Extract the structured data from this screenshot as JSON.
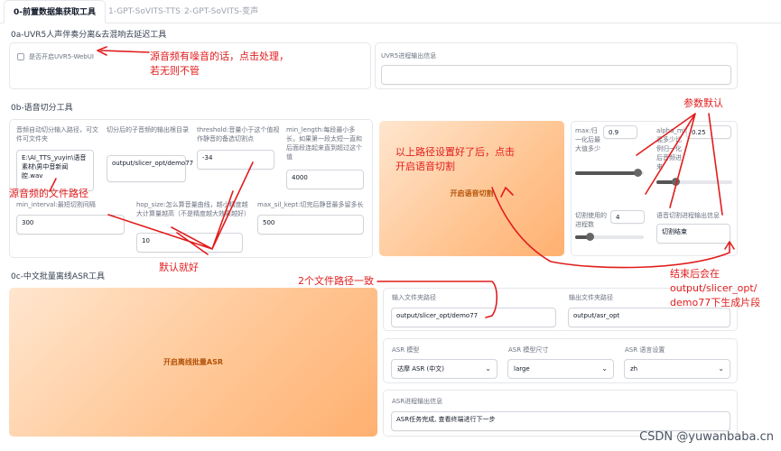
{
  "tabs": [
    {
      "label": "0-前置数据集获取工具"
    },
    {
      "label": "1-GPT-SoVITS-TTS"
    },
    {
      "label": "2-GPT-SoVITS-变声"
    }
  ],
  "uvr": {
    "title": "0a-UVR5人声伴奏分离&去混响去延迟工具",
    "checkbox_label": "是否开启UVR5-WebUI",
    "output_label": "UVR5进程输出信息"
  },
  "slice": {
    "title": "0b-语音切分工具",
    "input_label": "音频自动切分输入路径，可文件可文件夹",
    "input_value": "E:\\AI_TTS_yuyin\\语音素材\\男中音新闻腔.wav",
    "output_label": "切分后的子音频的输出根目录",
    "output_value": "output/slicer_opt/demo77",
    "threshold_label": "threshold:音量小于这个值视作静音的备选切割点",
    "threshold_value": "-34",
    "min_length_label": "min_length:每段最小多长，如果第一段太短一直和后面段连起来直到超过这个值",
    "min_length_value": "4000",
    "min_interval_label": "min_interval:最短切割间隔",
    "min_interval_value": "300",
    "hop_size_label": "hop_size:怎么算音量曲线，越小精度越大计算量越高（不是精度越大效果越好）",
    "hop_size_value": "10",
    "max_sil_label": "max_sil_kept:切完后静音最多留多长",
    "max_sil_value": "500",
    "button": "开启语音切割",
    "max_label": "max:归一化后最大值多少",
    "max_value": "0.9",
    "alpha_label": "alpha_mix:混多少比例归一化后音频进来",
    "alpha_value": "0.25",
    "threads_label": "切割使用的进程数",
    "threads_value": "4",
    "log_label": "语音切割进程输出信息",
    "log_value": "切割结束"
  },
  "asr": {
    "title": "0c-中文批量离线ASR工具",
    "button": "开启离线批量ASR",
    "input_label": "输入文件夹路径",
    "input_value": "output/slicer_opt/demo77",
    "output_label": "输出文件夹路径",
    "output_value": "output/asr_opt",
    "model_label": "ASR 模型",
    "model_value": "达摩 ASR (中文)",
    "size_label": "ASR 模型尺寸",
    "size_value": "large",
    "lang_label": "ASR 语言设置",
    "lang_value": "zh",
    "log_label": "ASR进程输出信息",
    "log_value": "ASR任务完成, 查看终端进行下一步"
  },
  "annotations": {
    "noise": "源音频有噪音的话，点击处理，",
    "noise2": "若无则不管",
    "params": "参数默认",
    "path_ready": "以上路径设置好了后，点击",
    "path_ready2": "开启语音切割",
    "source_path": "源音频的文件路径",
    "default": "默认就好",
    "two_paths": "2个文件路径一致",
    "after1": "结束后会在",
    "after2": "output/slicer_opt/",
    "after3": "demo77下生成片段"
  },
  "watermark": "CSDN @yuwanbaba.cn",
  "colors": {
    "annotation": "#e11d1d",
    "button_text": "#b45309"
  }
}
